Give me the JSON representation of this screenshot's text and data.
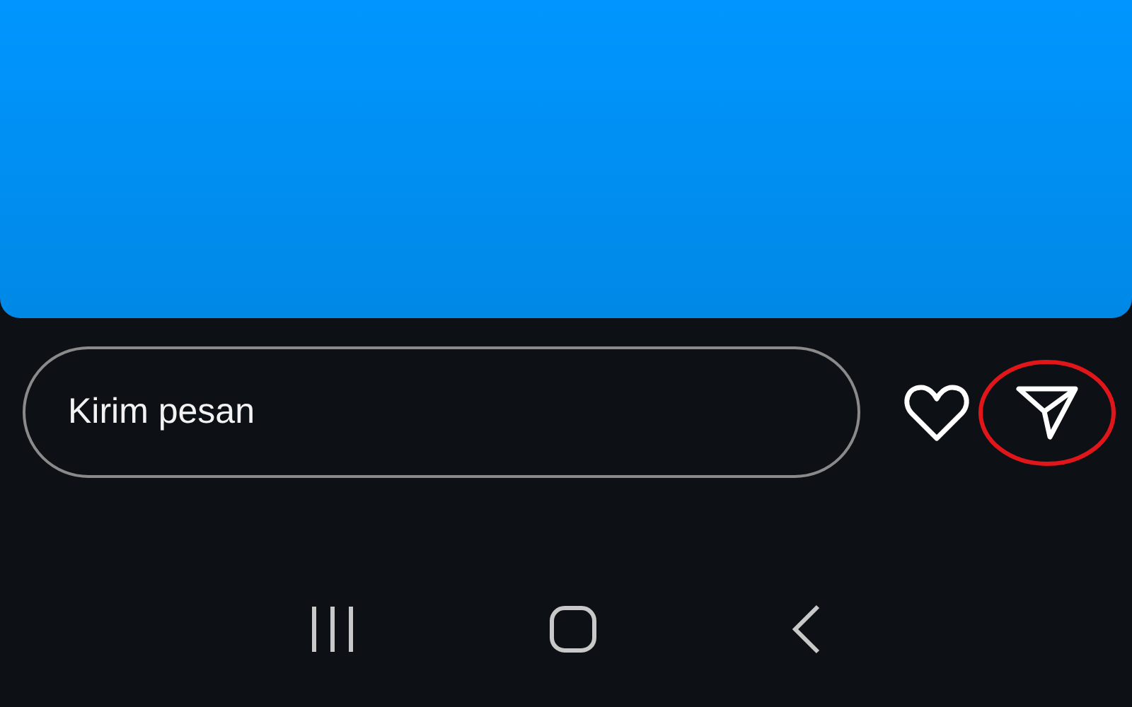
{
  "message_field": {
    "placeholder": "Kirim pesan"
  }
}
